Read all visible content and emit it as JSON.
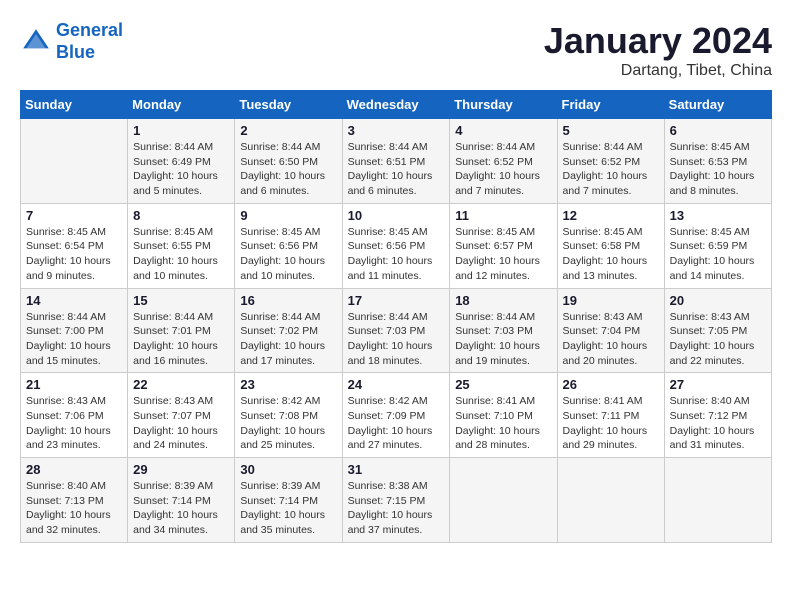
{
  "header": {
    "logo_line1": "General",
    "logo_line2": "Blue",
    "title": "January 2024",
    "subtitle": "Dartang, Tibet, China"
  },
  "columns": [
    "Sunday",
    "Monday",
    "Tuesday",
    "Wednesday",
    "Thursday",
    "Friday",
    "Saturday"
  ],
  "weeks": [
    [
      {
        "day": "",
        "info": ""
      },
      {
        "day": "1",
        "info": "Sunrise: 8:44 AM\nSunset: 6:49 PM\nDaylight: 10 hours\nand 5 minutes."
      },
      {
        "day": "2",
        "info": "Sunrise: 8:44 AM\nSunset: 6:50 PM\nDaylight: 10 hours\nand 6 minutes."
      },
      {
        "day": "3",
        "info": "Sunrise: 8:44 AM\nSunset: 6:51 PM\nDaylight: 10 hours\nand 6 minutes."
      },
      {
        "day": "4",
        "info": "Sunrise: 8:44 AM\nSunset: 6:52 PM\nDaylight: 10 hours\nand 7 minutes."
      },
      {
        "day": "5",
        "info": "Sunrise: 8:44 AM\nSunset: 6:52 PM\nDaylight: 10 hours\nand 7 minutes."
      },
      {
        "day": "6",
        "info": "Sunrise: 8:45 AM\nSunset: 6:53 PM\nDaylight: 10 hours\nand 8 minutes."
      }
    ],
    [
      {
        "day": "7",
        "info": "Sunrise: 8:45 AM\nSunset: 6:54 PM\nDaylight: 10 hours\nand 9 minutes."
      },
      {
        "day": "8",
        "info": "Sunrise: 8:45 AM\nSunset: 6:55 PM\nDaylight: 10 hours\nand 10 minutes."
      },
      {
        "day": "9",
        "info": "Sunrise: 8:45 AM\nSunset: 6:56 PM\nDaylight: 10 hours\nand 10 minutes."
      },
      {
        "day": "10",
        "info": "Sunrise: 8:45 AM\nSunset: 6:56 PM\nDaylight: 10 hours\nand 11 minutes."
      },
      {
        "day": "11",
        "info": "Sunrise: 8:45 AM\nSunset: 6:57 PM\nDaylight: 10 hours\nand 12 minutes."
      },
      {
        "day": "12",
        "info": "Sunrise: 8:45 AM\nSunset: 6:58 PM\nDaylight: 10 hours\nand 13 minutes."
      },
      {
        "day": "13",
        "info": "Sunrise: 8:45 AM\nSunset: 6:59 PM\nDaylight: 10 hours\nand 14 minutes."
      }
    ],
    [
      {
        "day": "14",
        "info": "Sunrise: 8:44 AM\nSunset: 7:00 PM\nDaylight: 10 hours\nand 15 minutes."
      },
      {
        "day": "15",
        "info": "Sunrise: 8:44 AM\nSunset: 7:01 PM\nDaylight: 10 hours\nand 16 minutes."
      },
      {
        "day": "16",
        "info": "Sunrise: 8:44 AM\nSunset: 7:02 PM\nDaylight: 10 hours\nand 17 minutes."
      },
      {
        "day": "17",
        "info": "Sunrise: 8:44 AM\nSunset: 7:03 PM\nDaylight: 10 hours\nand 18 minutes."
      },
      {
        "day": "18",
        "info": "Sunrise: 8:44 AM\nSunset: 7:03 PM\nDaylight: 10 hours\nand 19 minutes."
      },
      {
        "day": "19",
        "info": "Sunrise: 8:43 AM\nSunset: 7:04 PM\nDaylight: 10 hours\nand 20 minutes."
      },
      {
        "day": "20",
        "info": "Sunrise: 8:43 AM\nSunset: 7:05 PM\nDaylight: 10 hours\nand 22 minutes."
      }
    ],
    [
      {
        "day": "21",
        "info": "Sunrise: 8:43 AM\nSunset: 7:06 PM\nDaylight: 10 hours\nand 23 minutes."
      },
      {
        "day": "22",
        "info": "Sunrise: 8:43 AM\nSunset: 7:07 PM\nDaylight: 10 hours\nand 24 minutes."
      },
      {
        "day": "23",
        "info": "Sunrise: 8:42 AM\nSunset: 7:08 PM\nDaylight: 10 hours\nand 25 minutes."
      },
      {
        "day": "24",
        "info": "Sunrise: 8:42 AM\nSunset: 7:09 PM\nDaylight: 10 hours\nand 27 minutes."
      },
      {
        "day": "25",
        "info": "Sunrise: 8:41 AM\nSunset: 7:10 PM\nDaylight: 10 hours\nand 28 minutes."
      },
      {
        "day": "26",
        "info": "Sunrise: 8:41 AM\nSunset: 7:11 PM\nDaylight: 10 hours\nand 29 minutes."
      },
      {
        "day": "27",
        "info": "Sunrise: 8:40 AM\nSunset: 7:12 PM\nDaylight: 10 hours\nand 31 minutes."
      }
    ],
    [
      {
        "day": "28",
        "info": "Sunrise: 8:40 AM\nSunset: 7:13 PM\nDaylight: 10 hours\nand 32 minutes."
      },
      {
        "day": "29",
        "info": "Sunrise: 8:39 AM\nSunset: 7:14 PM\nDaylight: 10 hours\nand 34 minutes."
      },
      {
        "day": "30",
        "info": "Sunrise: 8:39 AM\nSunset: 7:14 PM\nDaylight: 10 hours\nand 35 minutes."
      },
      {
        "day": "31",
        "info": "Sunrise: 8:38 AM\nSunset: 7:15 PM\nDaylight: 10 hours\nand 37 minutes."
      },
      {
        "day": "",
        "info": ""
      },
      {
        "day": "",
        "info": ""
      },
      {
        "day": "",
        "info": ""
      }
    ]
  ]
}
